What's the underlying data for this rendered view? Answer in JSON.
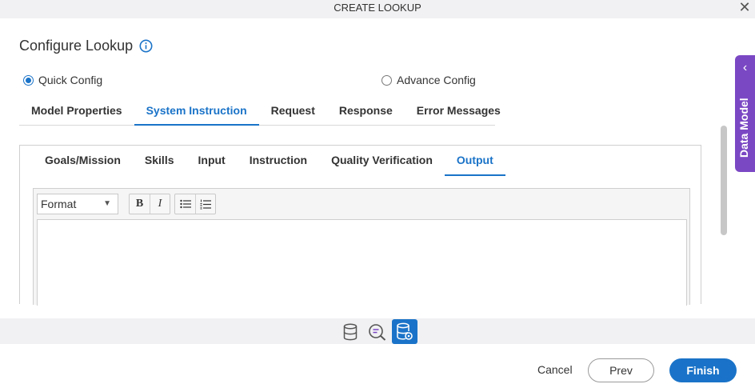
{
  "window": {
    "title": "CREATE LOOKUP",
    "close_icon": "close-icon"
  },
  "page": {
    "title": "Configure Lookup",
    "info_icon": "info-icon"
  },
  "config_mode": {
    "options": [
      {
        "label": "Quick Config",
        "selected": true
      },
      {
        "label": "Advance Config",
        "selected": false
      }
    ]
  },
  "main_tabs": [
    {
      "label": "Model Properties",
      "active": false
    },
    {
      "label": "System Instruction",
      "active": true
    },
    {
      "label": "Request",
      "active": false
    },
    {
      "label": "Response",
      "active": false
    },
    {
      "label": "Error Messages",
      "active": false
    }
  ],
  "sub_tabs": [
    {
      "label": "Goals/Mission",
      "active": false
    },
    {
      "label": "Skills",
      "active": false
    },
    {
      "label": "Input",
      "active": false
    },
    {
      "label": "Instruction",
      "active": false
    },
    {
      "label": "Quality Verification",
      "active": false
    },
    {
      "label": "Output",
      "active": true
    }
  ],
  "editor": {
    "format_label": "Format",
    "bold_label": "B",
    "italic_label": "I",
    "content": ""
  },
  "side_panel": {
    "label": "Data Model",
    "icon": "chevron-left-icon"
  },
  "bottom_icons": [
    {
      "icon": "database-icon",
      "active": false
    },
    {
      "icon": "chat-search-icon",
      "active": false
    },
    {
      "icon": "database-settings-icon",
      "active": true
    }
  ],
  "footer": {
    "cancel_label": "Cancel",
    "prev_label": "Prev",
    "finish_label": "Finish"
  },
  "colors": {
    "accent": "#1a73c8",
    "side_tab": "#7b48c4",
    "bar_bg": "#f1f1f3"
  }
}
